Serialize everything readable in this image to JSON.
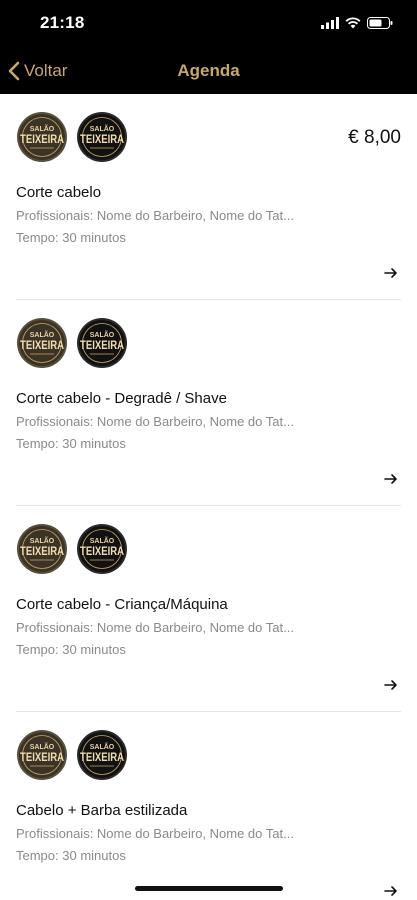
{
  "status_bar": {
    "time": "21:18",
    "icons": [
      "signal-icon",
      "wifi-icon",
      "battery-icon"
    ]
  },
  "nav": {
    "back_label": "Voltar",
    "title": "Agenda",
    "accent_color": "#c9a76a"
  },
  "logo": {
    "line1": "SALÃO",
    "line2": "TEIXEIRA"
  },
  "services": [
    {
      "name": "Corte cabelo",
      "price": "€ 8,00",
      "professionals": "Profissionais: Nome do Barbeiro, Nome do Tat...",
      "duration": "Tempo: 30 minutos"
    },
    {
      "name": "Corte cabelo - Degradê / Shave",
      "price": "",
      "professionals": "Profissionais: Nome do Barbeiro, Nome do Tat...",
      "duration": "Tempo: 30 minutos"
    },
    {
      "name": "Corte cabelo - Criança/Máquina",
      "price": "",
      "professionals": "Profissionais: Nome do Barbeiro, Nome do Tat...",
      "duration": "Tempo: 30 minutos"
    },
    {
      "name": "Cabelo + Barba estilizada",
      "price": "",
      "professionals": "Profissionais: Nome do Barbeiro, Nome do Tat...",
      "duration": "Tempo: 30 minutos"
    }
  ]
}
